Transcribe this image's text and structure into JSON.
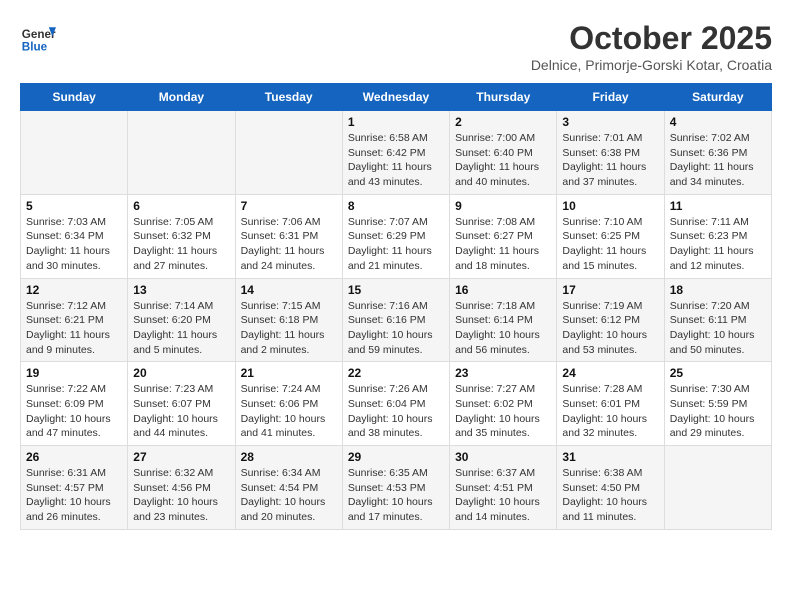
{
  "header": {
    "logo_line1": "General",
    "logo_line2": "Blue",
    "month": "October 2025",
    "location": "Delnice, Primorje-Gorski Kotar, Croatia"
  },
  "weekdays": [
    "Sunday",
    "Monday",
    "Tuesday",
    "Wednesday",
    "Thursday",
    "Friday",
    "Saturday"
  ],
  "rows": [
    [
      {
        "day": "",
        "info": ""
      },
      {
        "day": "",
        "info": ""
      },
      {
        "day": "",
        "info": ""
      },
      {
        "day": "1",
        "info": "Sunrise: 6:58 AM\nSunset: 6:42 PM\nDaylight: 11 hours and 43 minutes."
      },
      {
        "day": "2",
        "info": "Sunrise: 7:00 AM\nSunset: 6:40 PM\nDaylight: 11 hours and 40 minutes."
      },
      {
        "day": "3",
        "info": "Sunrise: 7:01 AM\nSunset: 6:38 PM\nDaylight: 11 hours and 37 minutes."
      },
      {
        "day": "4",
        "info": "Sunrise: 7:02 AM\nSunset: 6:36 PM\nDaylight: 11 hours and 34 minutes."
      }
    ],
    [
      {
        "day": "5",
        "info": "Sunrise: 7:03 AM\nSunset: 6:34 PM\nDaylight: 11 hours and 30 minutes."
      },
      {
        "day": "6",
        "info": "Sunrise: 7:05 AM\nSunset: 6:32 PM\nDaylight: 11 hours and 27 minutes."
      },
      {
        "day": "7",
        "info": "Sunrise: 7:06 AM\nSunset: 6:31 PM\nDaylight: 11 hours and 24 minutes."
      },
      {
        "day": "8",
        "info": "Sunrise: 7:07 AM\nSunset: 6:29 PM\nDaylight: 11 hours and 21 minutes."
      },
      {
        "day": "9",
        "info": "Sunrise: 7:08 AM\nSunset: 6:27 PM\nDaylight: 11 hours and 18 minutes."
      },
      {
        "day": "10",
        "info": "Sunrise: 7:10 AM\nSunset: 6:25 PM\nDaylight: 11 hours and 15 minutes."
      },
      {
        "day": "11",
        "info": "Sunrise: 7:11 AM\nSunset: 6:23 PM\nDaylight: 11 hours and 12 minutes."
      }
    ],
    [
      {
        "day": "12",
        "info": "Sunrise: 7:12 AM\nSunset: 6:21 PM\nDaylight: 11 hours and 9 minutes."
      },
      {
        "day": "13",
        "info": "Sunrise: 7:14 AM\nSunset: 6:20 PM\nDaylight: 11 hours and 5 minutes."
      },
      {
        "day": "14",
        "info": "Sunrise: 7:15 AM\nSunset: 6:18 PM\nDaylight: 11 hours and 2 minutes."
      },
      {
        "day": "15",
        "info": "Sunrise: 7:16 AM\nSunset: 6:16 PM\nDaylight: 10 hours and 59 minutes."
      },
      {
        "day": "16",
        "info": "Sunrise: 7:18 AM\nSunset: 6:14 PM\nDaylight: 10 hours and 56 minutes."
      },
      {
        "day": "17",
        "info": "Sunrise: 7:19 AM\nSunset: 6:12 PM\nDaylight: 10 hours and 53 minutes."
      },
      {
        "day": "18",
        "info": "Sunrise: 7:20 AM\nSunset: 6:11 PM\nDaylight: 10 hours and 50 minutes."
      }
    ],
    [
      {
        "day": "19",
        "info": "Sunrise: 7:22 AM\nSunset: 6:09 PM\nDaylight: 10 hours and 47 minutes."
      },
      {
        "day": "20",
        "info": "Sunrise: 7:23 AM\nSunset: 6:07 PM\nDaylight: 10 hours and 44 minutes."
      },
      {
        "day": "21",
        "info": "Sunrise: 7:24 AM\nSunset: 6:06 PM\nDaylight: 10 hours and 41 minutes."
      },
      {
        "day": "22",
        "info": "Sunrise: 7:26 AM\nSunset: 6:04 PM\nDaylight: 10 hours and 38 minutes."
      },
      {
        "day": "23",
        "info": "Sunrise: 7:27 AM\nSunset: 6:02 PM\nDaylight: 10 hours and 35 minutes."
      },
      {
        "day": "24",
        "info": "Sunrise: 7:28 AM\nSunset: 6:01 PM\nDaylight: 10 hours and 32 minutes."
      },
      {
        "day": "25",
        "info": "Sunrise: 7:30 AM\nSunset: 5:59 PM\nDaylight: 10 hours and 29 minutes."
      }
    ],
    [
      {
        "day": "26",
        "info": "Sunrise: 6:31 AM\nSunset: 4:57 PM\nDaylight: 10 hours and 26 minutes."
      },
      {
        "day": "27",
        "info": "Sunrise: 6:32 AM\nSunset: 4:56 PM\nDaylight: 10 hours and 23 minutes."
      },
      {
        "day": "28",
        "info": "Sunrise: 6:34 AM\nSunset: 4:54 PM\nDaylight: 10 hours and 20 minutes."
      },
      {
        "day": "29",
        "info": "Sunrise: 6:35 AM\nSunset: 4:53 PM\nDaylight: 10 hours and 17 minutes."
      },
      {
        "day": "30",
        "info": "Sunrise: 6:37 AM\nSunset: 4:51 PM\nDaylight: 10 hours and 14 minutes."
      },
      {
        "day": "31",
        "info": "Sunrise: 6:38 AM\nSunset: 4:50 PM\nDaylight: 10 hours and 11 minutes."
      },
      {
        "day": "",
        "info": ""
      }
    ]
  ]
}
